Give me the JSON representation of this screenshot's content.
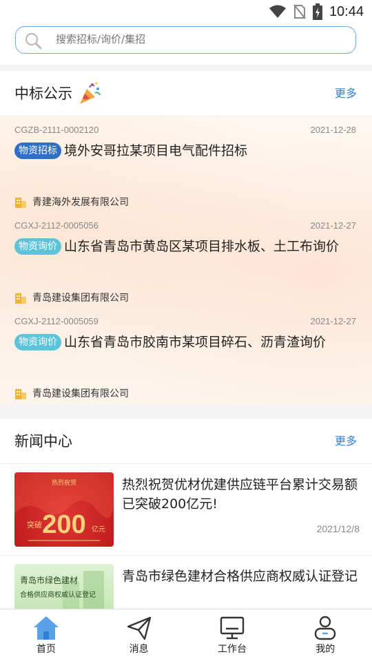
{
  "status_bar": {
    "time": "10:44"
  },
  "search": {
    "placeholder": "搜索招标/询价/集招"
  },
  "winning_section": {
    "title": "中标公示",
    "more": "更多",
    "items": [
      {
        "code": "CGZB-2111-0002120",
        "date": "2021-12-28",
        "tag": "物资招标",
        "tag_color": "#2f6fc6",
        "title": "境外安哥拉某项目电气配件招标",
        "company": "青建海外发展有限公司"
      },
      {
        "code": "CGXJ-2112-0005056",
        "date": "2021-12-27",
        "tag": "物资询价",
        "tag_color": "#5bc4d9",
        "title": "山东省青岛市黄岛区某项目排水板、土工布询价",
        "company": "青岛建设集团有限公司"
      },
      {
        "code": "CGXJ-2112-0005059",
        "date": "2021-12-27",
        "tag": "物资询价",
        "tag_color": "#5bc4d9",
        "title": "山东省青岛市胶南市某项目碎石、沥青渣询价",
        "company": "青岛建设集团有限公司"
      }
    ]
  },
  "news_section": {
    "title": "新闻中心",
    "more": "更多",
    "items": [
      {
        "title": "热烈祝贺优材优建供应链平台累计交易额已突破200亿元!",
        "date": "2021/12/8",
        "thumb_text_top": "热烈祝贺",
        "thumb_number": "200",
        "thumb_unit": "亿元",
        "thumb_prefix": "突破"
      },
      {
        "title": "青岛市绿色建材合格供应商权威认证登记",
        "date": "",
        "thumb_line1": "青岛市绿色建材",
        "thumb_line2": "合格供应商权威认证登记"
      }
    ]
  },
  "nav": [
    {
      "label": "首页",
      "icon": "home-icon",
      "active": true
    },
    {
      "label": "消息",
      "icon": "paper-plane-icon",
      "active": false
    },
    {
      "label": "工作台",
      "icon": "monitor-icon",
      "active": false
    },
    {
      "label": "我的",
      "icon": "user-icon",
      "active": false
    }
  ],
  "colors": {
    "accent": "#2f7fd6",
    "search_border": "#6aa7e6",
    "tag_blue": "#2f6fc6",
    "tag_cyan": "#5bc4d9"
  }
}
